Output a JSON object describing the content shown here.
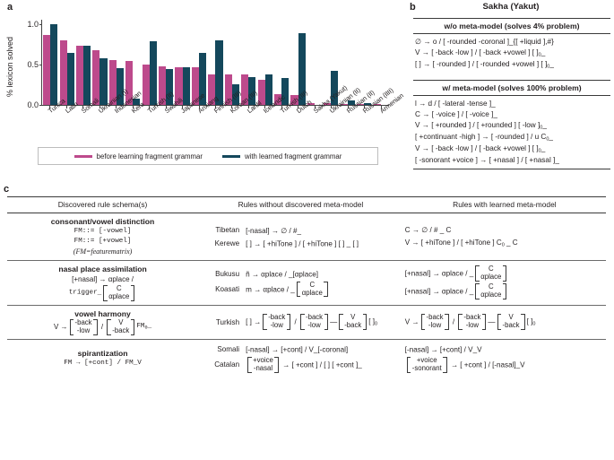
{
  "panels": {
    "a_letter": "a",
    "b_letter": "b",
    "c_letter": "c"
  },
  "chart_data": {
    "type": "bar",
    "title": "",
    "xlabel": "",
    "ylabel": "% lexicon solved",
    "ylim": [
      0,
      1.05
    ],
    "yticks": [
      "0.0",
      "0.5",
      "1.0"
    ],
    "grid": false,
    "legend_position": "bottom",
    "categories": [
      "Tunica",
      "Latin",
      "Somali",
      "Ukrainian (I)",
      "Indonesian",
      "Kera",
      "Turkish (II)",
      "Swahili",
      "Japanese",
      "Anxiang",
      "Finnish (III)",
      "Korean (III)",
      "Lardil",
      "Icelandic",
      "Turkish (III)",
      "Dutch",
      "Sakha (Yakut)",
      "Ukrainian (II)",
      "Russian (II)",
      "Russian (IIII)",
      "Armenian"
    ],
    "series": [
      {
        "name": "before learning fragment grammar",
        "color": "#bd4a8c",
        "values": [
          0.86,
          0.8,
          0.73,
          0.67,
          0.55,
          0.54,
          0.5,
          0.48,
          0.46,
          0.46,
          0.38,
          0.38,
          0.38,
          0.31,
          0.13,
          0.12,
          0.02,
          0.02,
          0.01,
          0.01,
          0.01
        ]
      },
      {
        "name": "with learned fragment grammar",
        "color": "#14485c",
        "values": [
          1.0,
          0.64,
          0.73,
          0.57,
          0.45,
          0.08,
          0.78,
          0.44,
          0.46,
          0.64,
          0.8,
          0.25,
          0.34,
          0.38,
          0.33,
          0.88,
          0.0,
          0.42,
          0.05,
          0.02,
          0.0
        ]
      }
    ]
  },
  "panel_b": {
    "title": "Sakha (Yakut)",
    "sections": [
      {
        "header": "w/o meta-model (solves 4% problem)",
        "rules": [
          "∅ → o / [ -rounded -coronal ]_{[ +liquid ],#}",
          "V → [ -back -low ] / [ -back +vowel ] [ ]₀_",
          "[ ] → [ -rounded ] / [ -rounded +vowel ] [ ]₀_"
        ]
      },
      {
        "header": "w/ meta-model (solves 100% problem)",
        "rules": [
          "l → d / [ -lateral -tense ]_",
          "C → [ -voice ] / [ -voice ]_",
          "V → [ +rounded ] / [ +rounded ] [ -low ]₀_",
          "[ +continuant -high ] → [ -rounded ] / u C₀_",
          "V → [ -back -low ] / [ -back +vowel ] [ ]₀_",
          "[ -sonorant +voice ] → [ +nasal ] / [ +nasal ]_"
        ]
      }
    ]
  },
  "panel_c": {
    "headers": [
      "Discovered rule schema(s)",
      "Rules without discovered meta-model",
      "Rules with learned meta-model"
    ],
    "rows": [
      {
        "schema_title": "consonant/vowel distinction",
        "schema_lines": [
          "FM::= [-vowel]",
          "FM::= [+vowel]",
          "(FM=featurematrix)"
        ],
        "examples": [
          {
            "language": "Tibetan",
            "without": "[-nasal] → ∅ / #_",
            "with": "C → ∅ / # _ C"
          },
          {
            "language": "Kerewe",
            "without": "[ ] → [ +hiTone ] / [ +hiTone ] [ ] _ [ ]",
            "with": "V → [ +hiTone ] / [ +hiTone ] C₀ _ C"
          }
        ]
      },
      {
        "schema_title": "nasal place assimilation",
        "schema_lines": [
          "[+nasal] → αplace /",
          "trigger_"
        ],
        "schema_matrix": [
          "C",
          "αplace"
        ],
        "examples": [
          {
            "language": "Bukusu",
            "without": "ñ → αplace / _[αplace]",
            "without_prefix": "",
            "with_prefix": "[+nasal] → αplace / _",
            "with_matrix": [
              "C",
              "αplace"
            ]
          },
          {
            "language": "Koasati",
            "without_prefix": "m → αplace / _",
            "without_matrix": [
              "C",
              "αplace"
            ],
            "with_prefix": "[+nasal] → αplace / _",
            "with_matrix": [
              "C",
              "αplace"
            ]
          }
        ]
      },
      {
        "schema_title": "vowel harmony",
        "schema_prefix": "V →",
        "schema_m1": [
          "-back",
          "-low"
        ],
        "schema_sep": "/",
        "schema_m2": [
          "V",
          "-back"
        ],
        "schema_suffix": "FM₀_",
        "examples": [
          {
            "language": "Turkish",
            "without_prefix": "[ ] →",
            "without_m1": [
              "-back",
              "-low"
            ],
            "without_sep": "/",
            "without_m2": [
              "-back",
              "-low"
            ],
            "without_dash": "—",
            "without_m3": [
              "V",
              "-back"
            ],
            "without_suffix": "[ ]₀",
            "with_prefix": "V →",
            "with_m1": [
              "-back",
              "-low"
            ],
            "with_sep": "/",
            "with_m2": [
              "-back",
              "-low"
            ],
            "with_dash": "—",
            "with_m3": [
              "V",
              "-back"
            ],
            "with_suffix": "[ ]₀"
          }
        ]
      },
      {
        "schema_title": "spirantization",
        "schema_lines": [
          "FM → [+cont] / FM_V"
        ],
        "examples": [
          {
            "language": "Somali",
            "without": "[-nasal] → [+cont] / V_[-coronal]",
            "with": "[-nasal] → [+cont] / V_V"
          },
          {
            "language": "Catalan",
            "without_matrix": [
              "+voice",
              "-nasal"
            ],
            "without_suffix": "→ [ +cont ] / [ ] [ +cont ]_",
            "with_matrix": [
              "+voice",
              "-sonorant"
            ],
            "with_suffix": "→ [ +cont ] / [-nasal]_V"
          }
        ]
      }
    ]
  }
}
